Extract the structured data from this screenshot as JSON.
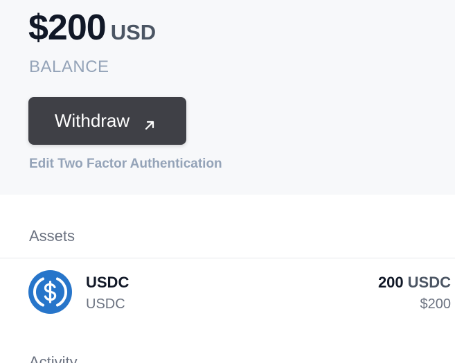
{
  "balance": {
    "amount": "$200",
    "currency": "USD",
    "label": "BALANCE"
  },
  "actions": {
    "withdraw_label": "Withdraw",
    "withdraw_icon": "arrow-up-right-icon",
    "two_factor_link": "Edit Two Factor Authentication"
  },
  "assets": {
    "heading": "Assets",
    "items": [
      {
        "icon": "usdc-coin-icon",
        "name": "USDC",
        "symbol": "USDC",
        "quantity": "200",
        "quantity_unit": "USDC",
        "usd_value": "$200"
      }
    ]
  },
  "activity": {
    "heading": "Activity"
  },
  "colors": {
    "panel_background": "#f7f8fa",
    "button_background": "#3f4046",
    "muted_text": "#94a3b8",
    "usdc_blue": "#2775ca"
  }
}
